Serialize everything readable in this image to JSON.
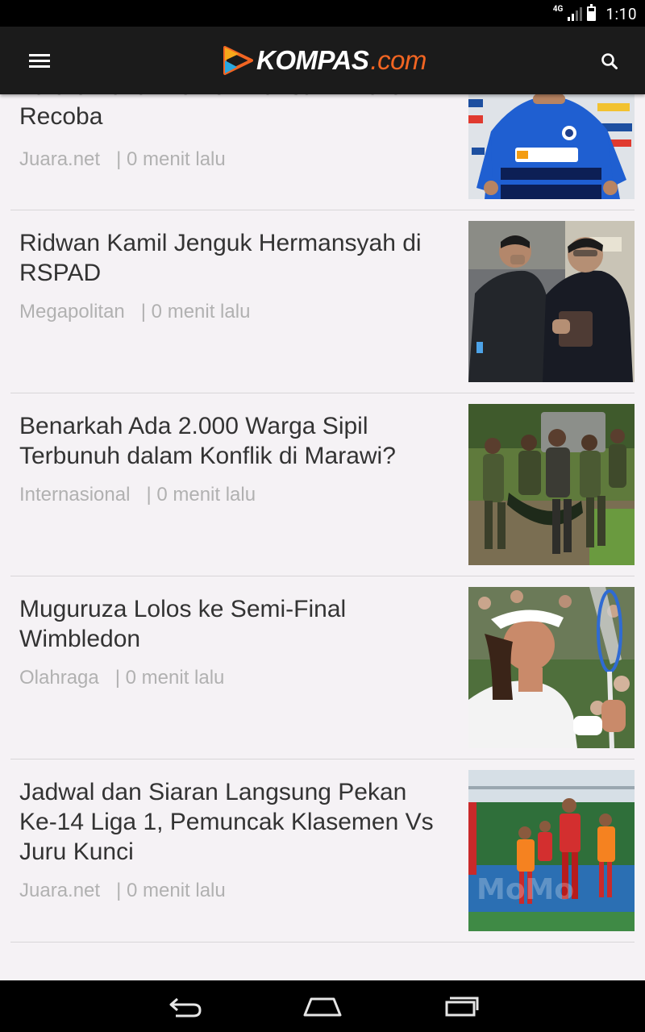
{
  "status_bar": {
    "network": "4G",
    "time": "1:10",
    "icons": [
      "signal-icon",
      "battery-icon"
    ]
  },
  "app_bar": {
    "menu_icon": "hamburger-menu-icon",
    "logo_primary": "KOMPAS",
    "logo_suffix": ".com",
    "search_icon": "search-icon",
    "brand_colors": {
      "bar": "#1b1b1b",
      "accent": "#f26522",
      "logo_text": "#ffffff"
    }
  },
  "articles": [
    {
      "title": "Valero Pakai Nomor Warisan Alvaro Recoba",
      "category": "Juara.net",
      "time": "| 0 menit lalu",
      "thumbnail": "football-player-jersey-photo"
    },
    {
      "title": "Ridwan Kamil Jenguk Hermansyah di RSPAD",
      "category": "Megapolitan",
      "time": "| 0 menit lalu",
      "thumbnail": "hospital-visit-photo"
    },
    {
      "title": "Benarkah Ada 2.000 Warga Sipil Terbunuh dalam Konflik di Marawi?",
      "category": "Internasional",
      "time": "| 0 menit lalu",
      "thumbnail": "soldiers-carrying-body-photo"
    },
    {
      "title": "Muguruza Lolos ke Semi-Final Wimbledon",
      "category": "Olahraga",
      "time": "| 0 menit lalu",
      "thumbnail": "tennis-player-photo"
    },
    {
      "title": "Jadwal dan Siaran Langsung Pekan Ke-14 Liga 1, Pemuncak Klasemen Vs Juru Kunci",
      "category": "Juara.net",
      "time": "| 0 menit lalu",
      "thumbnail": "football-match-photo"
    }
  ],
  "nav_bar": {
    "icons": [
      "back-icon",
      "home-icon",
      "recents-icon"
    ]
  }
}
